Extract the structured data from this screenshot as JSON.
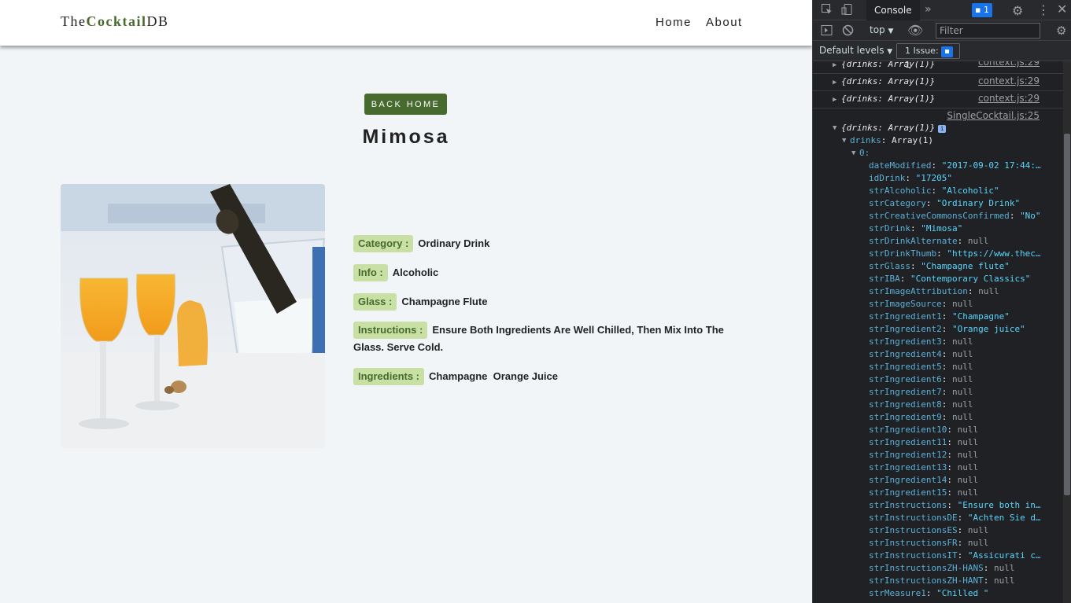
{
  "navbar": {
    "logo_prefix": "The",
    "logo_brand": "Cocktail",
    "logo_suffix": "DB",
    "links": [
      "Home",
      "About"
    ]
  },
  "main": {
    "back_button": "BACK HOME",
    "title": "Mimosa",
    "info": [
      {
        "label": "Category :",
        "value": "Ordinary Drink"
      },
      {
        "label": "Info :",
        "value": "Alcoholic"
      },
      {
        "label": "Glass :",
        "value": "Champagne Flute"
      },
      {
        "label": "Instructions :",
        "value": "Ensure Both Ingredients Are Well Chilled, Then Mix Into The Glass. Serve Cold."
      },
      {
        "label": "Ingredients :",
        "value": "Champagne  Orange Juice"
      }
    ]
  },
  "devtools": {
    "tabs": [
      "Console",
      "»"
    ],
    "message_count": "1",
    "context": "top",
    "filter_placeholder": "Filter",
    "levels": "Default levels",
    "issues": "1 Issue:",
    "issues_count": "1",
    "logs": [
      {
        "text": "{drinks: Array(1)}",
        "link": "context.js:29"
      },
      {
        "text": "{drinks: Array(1)}",
        "link": "context.js:29"
      },
      {
        "text": "{drinks: Array(1)}",
        "link": "context.js:29"
      }
    ],
    "expanded_link": "SingleCocktail.js:25",
    "expanded_summary": "{drinks: Array(1)}",
    "drinks_label": "drinks",
    "drinks_type": "Array(1)",
    "index_label": "0:",
    "properties": [
      {
        "key": "dateModified",
        "value": "\"2017-09-02 17:44:…",
        "type": "str"
      },
      {
        "key": "idDrink",
        "value": "\"17205\"",
        "type": "str"
      },
      {
        "key": "strAlcoholic",
        "value": "\"Alcoholic\"",
        "type": "str"
      },
      {
        "key": "strCategory",
        "value": "\"Ordinary Drink\"",
        "type": "str"
      },
      {
        "key": "strCreativeCommonsConfirmed",
        "value": "\"No\"",
        "type": "str"
      },
      {
        "key": "strDrink",
        "value": "\"Mimosa\"",
        "type": "str"
      },
      {
        "key": "strDrinkAlternate",
        "value": "null",
        "type": "null"
      },
      {
        "key": "strDrinkThumb",
        "value": "\"https://www.thec…",
        "type": "str"
      },
      {
        "key": "strGlass",
        "value": "\"Champagne flute\"",
        "type": "str"
      },
      {
        "key": "strIBA",
        "value": "\"Contemporary Classics\"",
        "type": "str"
      },
      {
        "key": "strImageAttribution",
        "value": "null",
        "type": "null"
      },
      {
        "key": "strImageSource",
        "value": "null",
        "type": "null"
      },
      {
        "key": "strIngredient1",
        "value": "\"Champagne\"",
        "type": "str"
      },
      {
        "key": "strIngredient2",
        "value": "\"Orange juice\"",
        "type": "str"
      },
      {
        "key": "strIngredient3",
        "value": "null",
        "type": "null"
      },
      {
        "key": "strIngredient4",
        "value": "null",
        "type": "null"
      },
      {
        "key": "strIngredient5",
        "value": "null",
        "type": "null"
      },
      {
        "key": "strIngredient6",
        "value": "null",
        "type": "null"
      },
      {
        "key": "strIngredient7",
        "value": "null",
        "type": "null"
      },
      {
        "key": "strIngredient8",
        "value": "null",
        "type": "null"
      },
      {
        "key": "strIngredient9",
        "value": "null",
        "type": "null"
      },
      {
        "key": "strIngredient10",
        "value": "null",
        "type": "null"
      },
      {
        "key": "strIngredient11",
        "value": "null",
        "type": "null"
      },
      {
        "key": "strIngredient12",
        "value": "null",
        "type": "null"
      },
      {
        "key": "strIngredient13",
        "value": "null",
        "type": "null"
      },
      {
        "key": "strIngredient14",
        "value": "null",
        "type": "null"
      },
      {
        "key": "strIngredient15",
        "value": "null",
        "type": "null"
      },
      {
        "key": "strInstructions",
        "value": "\"Ensure both in…",
        "type": "str"
      },
      {
        "key": "strInstructionsDE",
        "value": "\"Achten Sie d…",
        "type": "str"
      },
      {
        "key": "strInstructionsES",
        "value": "null",
        "type": "null"
      },
      {
        "key": "strInstructionsFR",
        "value": "null",
        "type": "null"
      },
      {
        "key": "strInstructionsIT",
        "value": "\"Assicurati c…",
        "type": "str"
      },
      {
        "key": "strInstructionsZH-HANS",
        "value": "null",
        "type": "null"
      },
      {
        "key": "strInstructionsZH-HANT",
        "value": "null",
        "type": "null"
      },
      {
        "key": "strMeasure1",
        "value": "\"Chilled \"",
        "type": "str"
      }
    ]
  },
  "colors": {
    "brand_green": "#476a2e",
    "label_bg": "#c9e0a5",
    "page_bg": "#f1f5f8",
    "devtools_bg": "#202124"
  }
}
